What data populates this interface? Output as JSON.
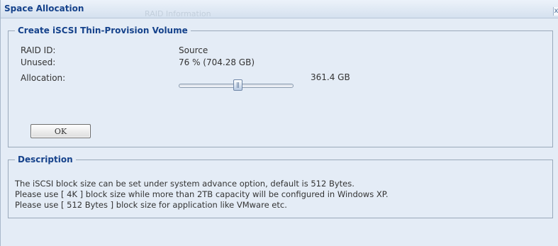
{
  "window": {
    "title": "Space Allocation",
    "background_title": "RAID Information",
    "close_label": "x"
  },
  "create_section": {
    "legend": "Create iSCSI Thin-Provision Volume",
    "raid_id_label": "RAID ID:",
    "raid_id_value": "Source",
    "unused_label": "Unused:",
    "unused_value": "76 % (704.28 GB)",
    "allocation_label": "Allocation:",
    "allocation_value": "361.4 GB",
    "ok_label": "OK"
  },
  "description_section": {
    "legend": "Description",
    "lines": [
      "The iSCSI block size can be set under system advance option, default is 512 Bytes.",
      "Please use [ 4K ] block size while more than 2TB capacity will be configured in Windows XP.",
      "Please use [ 512 Bytes ] block size for application like VMware etc."
    ]
  },
  "colors": {
    "title_text": "#15428b",
    "panel_background": "#e4ecf6",
    "border": "#9aa9ba"
  }
}
